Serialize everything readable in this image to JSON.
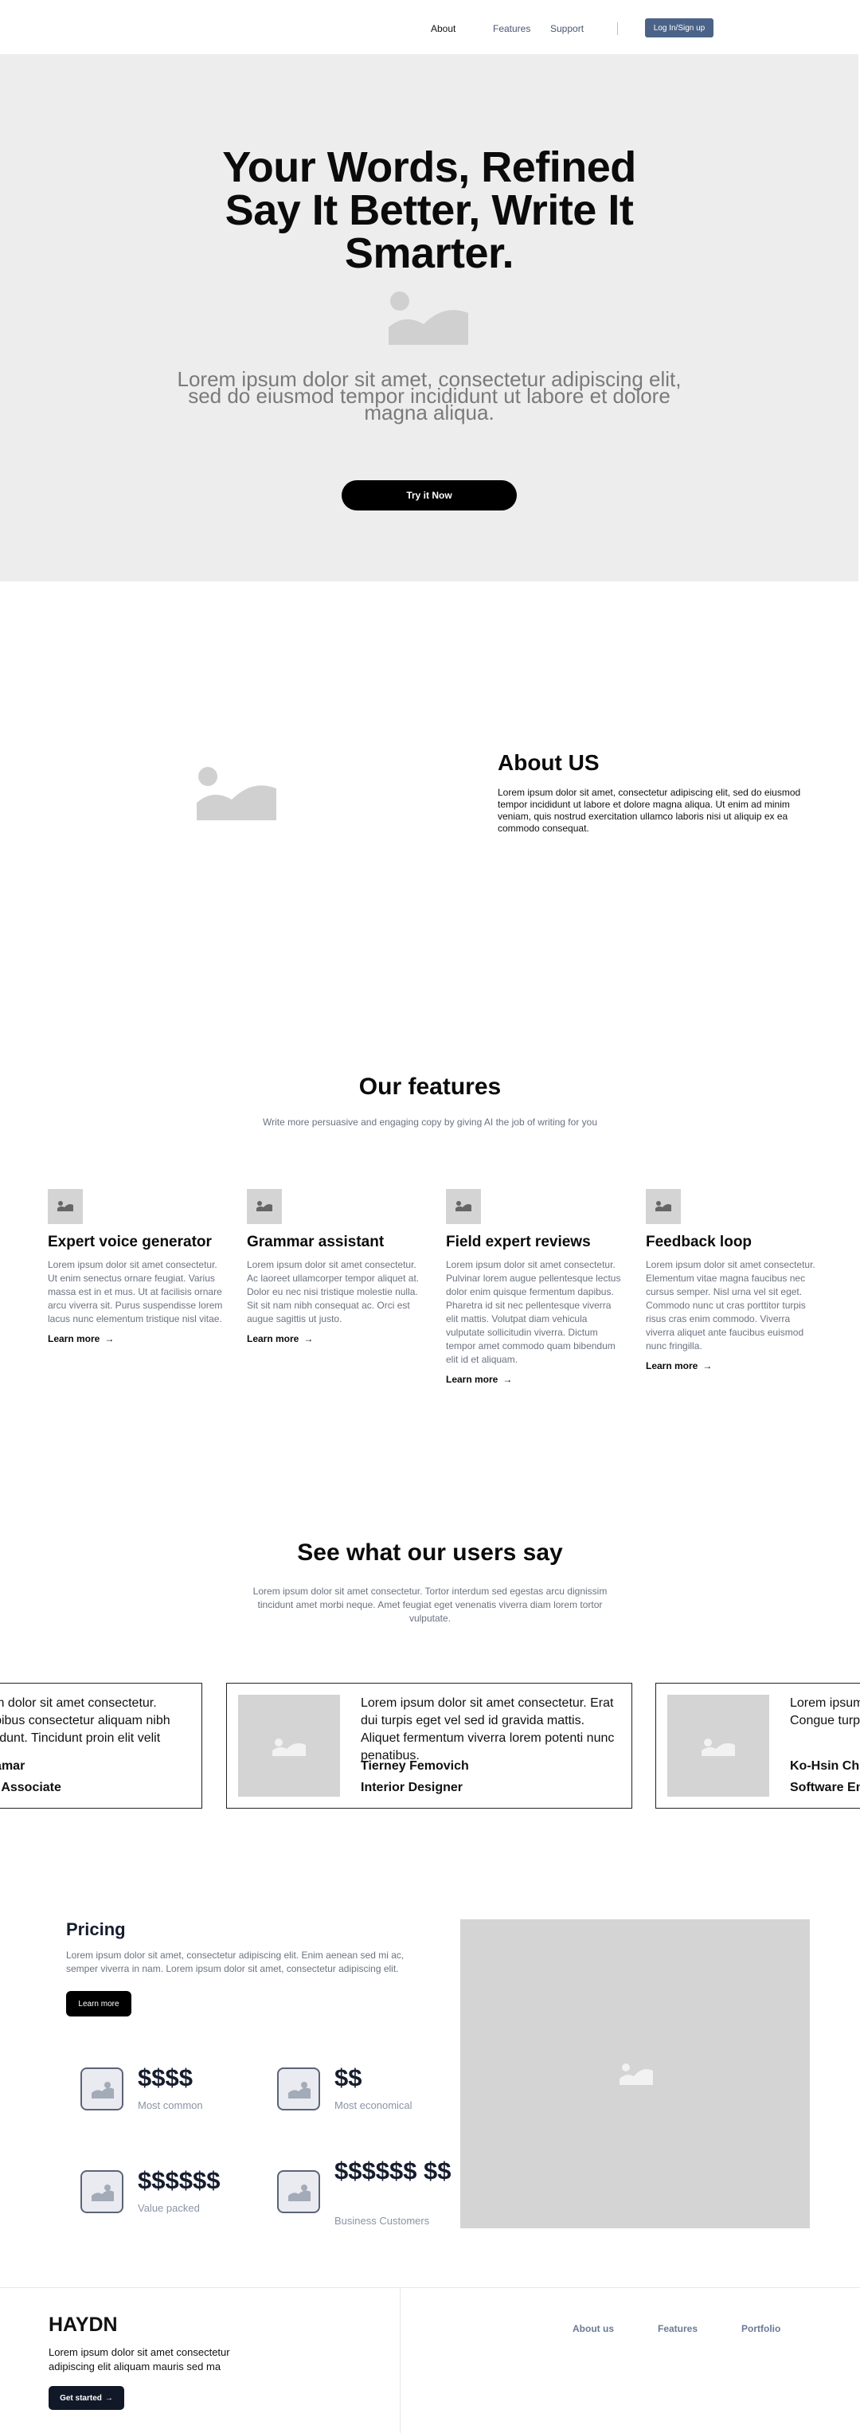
{
  "nav": {
    "links": [
      "About",
      "Features",
      "Support"
    ],
    "cta": "Log In/Sign up"
  },
  "hero": {
    "title": "Your Words, Refined Say It Better, Write It Smarter.",
    "subtitle": "Lorem ipsum dolor sit amet, consectetur adipiscing elit, sed do eiusmod tempor incididunt ut labore et dolore magna aliqua.",
    "button": "Try it Now"
  },
  "about": {
    "title": "About US",
    "text": "Lorem ipsum dolor sit amet, consectetur adipiscing elit, sed do eiusmod tempor incididunt ut labore et dolore magna aliqua. Ut enim ad minim veniam, quis nostrud exercitation ullamco laboris nisi ut aliquip ex ea commodo consequat."
  },
  "features": {
    "title": "Our features",
    "subtitle": "Write more persuasive and engaging copy by giving AI the job of writing for you",
    "learn_more": "Learn more",
    "items": [
      {
        "title": "Expert voice generator",
        "text": "Lorem ipsum dolor sit amet consectetur. Ut enim senectus ornare feugiat. Varius massa est in et mus. Ut at facilisis ornare arcu viverra sit. Purus suspendisse lorem lacus nunc elementum tristique nisl vitae."
      },
      {
        "title": "Grammar assistant",
        "text": "Lorem ipsum dolor sit amet consectetur. Ac laoreet ullamcorper tempor aliquet at. Dolor eu nec nisi tristique molestie nulla. Sit sit nam nibh consequat ac. Orci est augue sagittis ut justo."
      },
      {
        "title": "Field expert reviews",
        "text": "Lorem ipsum dolor sit amet consectetur. Pulvinar lorem augue pellentesque lectus dolor enim quisque fermentum dapibus. Pharetra id sit nec pellentesque viverra elit mattis. Volutpat diam vehicula vulputate sollicitudin viverra. Dictum tempor amet commodo quam bibendum elit id et aliquam."
      },
      {
        "title": "Feedback loop",
        "text": "Lorem ipsum dolor sit amet consectetur. Elementum vitae magna faucibus nec cursus semper. Nisl urna vel sit eget. Commodo nunc ut cras porttitor turpis risus cras enim commodo. Viverra viverra aliquet ante faucibus euismod nunc fringilla."
      }
    ]
  },
  "testimonials": {
    "title": "See what our users say",
    "subtitle": "Lorem ipsum dolor sit amet consectetur. Tortor interdum sed egestas arcu dignissim tincidunt amet morbi neque. Amet feugiat eget venenatis viverra diam lorem tortor vulputate.",
    "cards": [
      {
        "quote": "Lorem ipsum dolor sit amet consectetur. Sodales dapibus consectetur aliquam nibh pretium tincidunt. Tincidunt proin elit velit amet.",
        "name": "Sakshi Vetamar",
        "role": "Operations Associate"
      },
      {
        "quote": "Lorem ipsum dolor sit amet consectetur. Erat dui turpis eget vel sed id gravida mattis. Aliquet fermentum viverra lorem potenti nunc penatibus.",
        "name": "Tierney Femovich",
        "role": "Interior Designer"
      },
      {
        "quote": "Lorem ipsum dolor sit amet consectetur. Congue turpis eget nibh. Gravida.",
        "name": "Ko-Hsin Chu",
        "role": "Software Engineer"
      }
    ]
  },
  "pricing": {
    "title": "Pricing",
    "text": "Lorem ipsum dolor sit amet, consectetur adipiscing elit. Enim aenean sed mi ac, semper viverra in nam. Lorem ipsum dolor sit amet, consectetur adipiscing elit.",
    "button": "Learn more",
    "plans": [
      {
        "price": "$$$$",
        "label": "Most common"
      },
      {
        "price": "$$",
        "label": "Most economical"
      },
      {
        "price": "$$$$$$",
        "label": "Value packed"
      },
      {
        "price": "$$$$$$ $$",
        "label": "Business Customers"
      }
    ]
  },
  "footer": {
    "brand": "HAYDN",
    "text": "Lorem ipsum dolor sit amet consectetur adipiscing elit aliquam mauris sed ma",
    "button": "Get started",
    "links": [
      "About us",
      "Features",
      "Portfolio"
    ]
  }
}
